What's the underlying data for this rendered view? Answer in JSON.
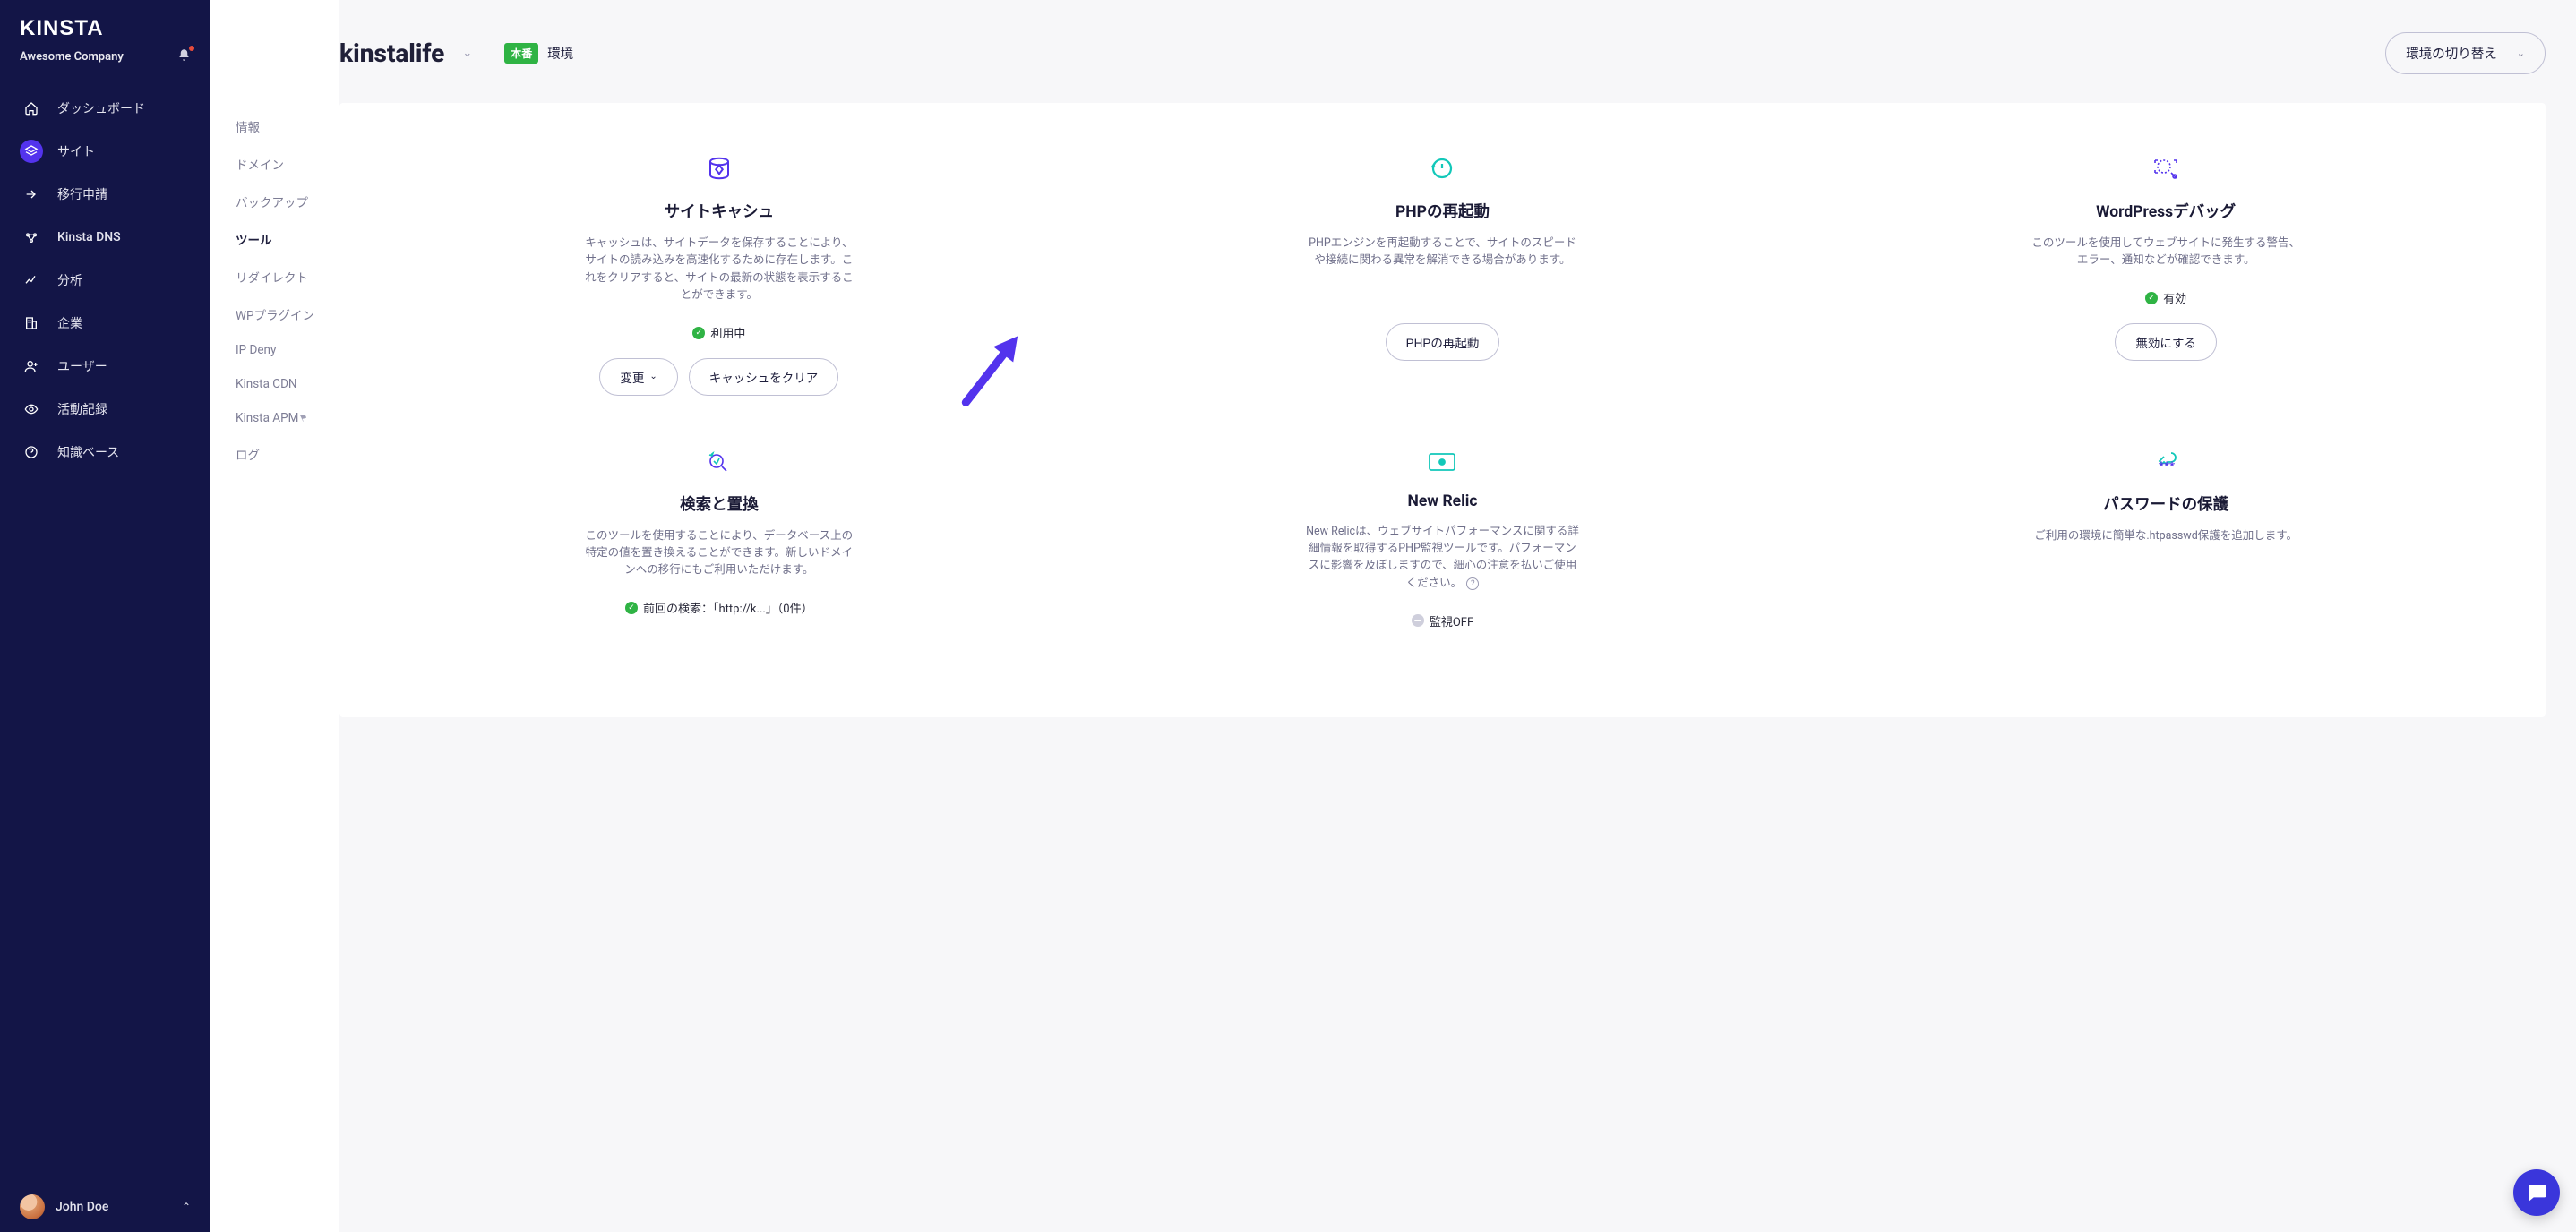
{
  "brand": "KINSTA",
  "company": "Awesome Company",
  "nav": {
    "items": [
      {
        "label": "ダッシュボード",
        "icon": "home"
      },
      {
        "label": "サイト",
        "icon": "layers",
        "active": true
      },
      {
        "label": "移行申請",
        "icon": "arrow-right"
      },
      {
        "label": "Kinsta DNS",
        "icon": "dns"
      },
      {
        "label": "分析",
        "icon": "chart"
      },
      {
        "label": "企業",
        "icon": "building"
      },
      {
        "label": "ユーザー",
        "icon": "user-plus"
      },
      {
        "label": "活動記録",
        "icon": "eye"
      },
      {
        "label": "知識ベース",
        "icon": "question"
      }
    ]
  },
  "user": {
    "name": "John Doe"
  },
  "subnav": {
    "items": [
      {
        "label": "情報"
      },
      {
        "label": "ドメイン"
      },
      {
        "label": "バックアップ"
      },
      {
        "label": "ツール",
        "active": true
      },
      {
        "label": "リダイレクト"
      },
      {
        "label": "WPプラグイン"
      },
      {
        "label": "IP Deny"
      },
      {
        "label": "Kinsta CDN"
      },
      {
        "label": "Kinsta APM",
        "flag": true
      },
      {
        "label": "ログ"
      }
    ]
  },
  "header": {
    "site": "kinstalife",
    "badge": "本番",
    "env_label": "環境",
    "switch_label": "環境の切り替え"
  },
  "cards": [
    {
      "title": "サイトキャシュ",
      "desc": "キャッシュは、サイトデータを保存することにより、サイトの読み込みを高速化するために存在します。これをクリアすると、サイトの最新の状態を表示することができます。",
      "status": {
        "type": "green",
        "text": "利用中"
      },
      "buttons": [
        {
          "label": "変更",
          "chev": true
        },
        {
          "label": "キャッシュをクリア"
        }
      ],
      "icon": "cache"
    },
    {
      "title": "PHPの再起動",
      "desc": "PHPエンジンを再起動することで、サイトのスピードや接続に関わる異常を解消できる場合があります。",
      "status": null,
      "buttons": [
        {
          "label": "PHPの再起動"
        }
      ],
      "icon": "restart"
    },
    {
      "title": "WordPressデバッグ",
      "desc": "このツールを使用してウェブサイトに発生する警告、エラー、通知などが確認できます。",
      "status": {
        "type": "green",
        "text": "有効"
      },
      "buttons": [
        {
          "label": "無効にする"
        }
      ],
      "icon": "debug"
    },
    {
      "title": "検索と置換",
      "desc": "このツールを使用することにより、データベース上の特定の値を置き換えることができます。新しいドメインへの移行にもご利用いただけます。",
      "status": {
        "type": "green",
        "text": "前回の検索：「http://k...」（0件）"
      },
      "buttons": [],
      "icon": "search-replace"
    },
    {
      "title": "New Relic",
      "desc": "New Relicは、ウェブサイトパフォーマンスに関する詳細情報を取得するPHP監視ツールです。パフォーマンスに影響を及ぼしますので、細心の注意を払いご使用ください。",
      "info": true,
      "status": {
        "type": "gray",
        "text": "監視OFF"
      },
      "buttons": [],
      "icon": "new-relic"
    },
    {
      "title": "パスワードの保護",
      "desc": "ご利用の環境に簡単な.htpasswd保護を追加します。",
      "status": null,
      "buttons": [],
      "icon": "password"
    }
  ]
}
